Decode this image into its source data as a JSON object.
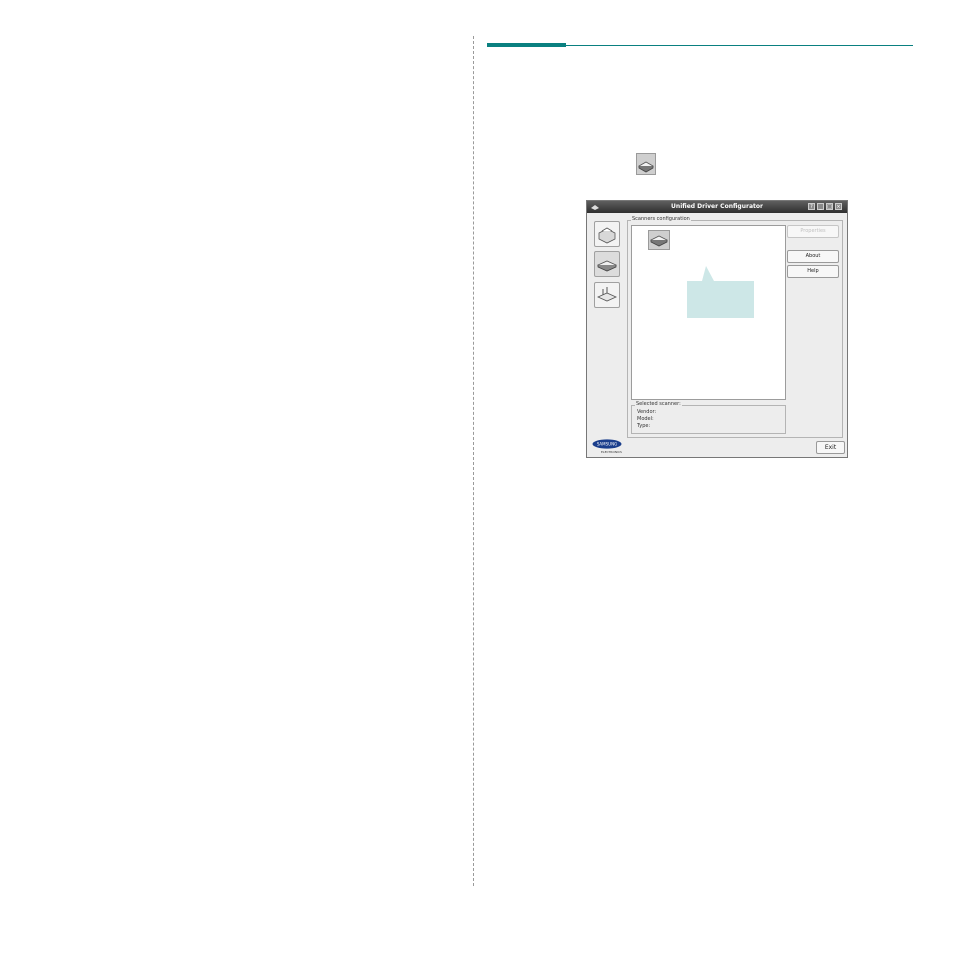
{
  "window": {
    "title": "Unified Driver Configurator",
    "title_buttons": [
      "?",
      "_",
      "□",
      "×"
    ]
  },
  "sidebar": {
    "items": [
      {
        "name": "printers-configuration",
        "icon": "printer-icon"
      },
      {
        "name": "scanners-configuration",
        "icon": "scanner-icon",
        "active": true
      },
      {
        "name": "ports-configuration",
        "icon": "port-icon"
      }
    ]
  },
  "scanners_group": {
    "legend": "Scanners configuration"
  },
  "selected_scanner": {
    "legend": "Selected scanner:",
    "vendor_label": "Vendor:",
    "model_label": "Model:",
    "type_label": "Type:"
  },
  "buttons": {
    "properties": "Properties",
    "about": "About",
    "help": "Help",
    "exit": "Exit"
  },
  "brand": {
    "logo_text": "SAMSUNG",
    "logo_sub": "ELECTRONICS"
  },
  "colors": {
    "accent": "#0a8080",
    "callout": "#cde7e7"
  }
}
